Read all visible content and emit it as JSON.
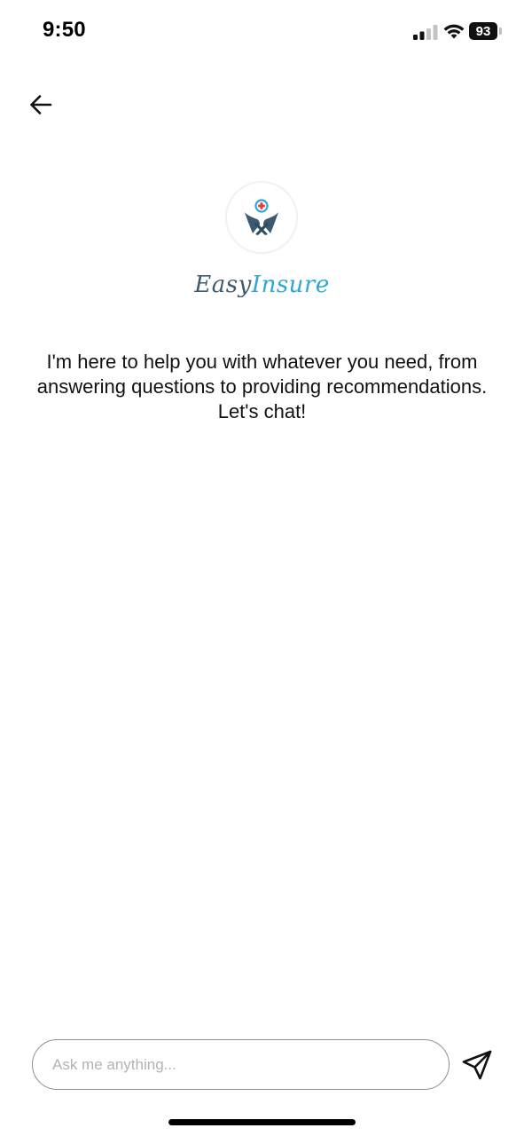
{
  "status_bar": {
    "time": "9:50",
    "battery_level": "93",
    "signal_icon": "cellular-signal-icon",
    "wifi_icon": "wifi-icon"
  },
  "nav": {
    "back_icon": "arrow-left-icon"
  },
  "brand": {
    "logo_icon": "hands-medical-cross-icon",
    "name_part_1": "Easy",
    "name_part_2": "Insure",
    "primary_color": "#3d5a70",
    "accent_color": "#2ea6d6",
    "cross_color": "#e03a3a"
  },
  "intro": {
    "message": "I'm here to help you with whatever you need, from answering questions to providing recommendations. Let's chat!"
  },
  "chat": {
    "input_placeholder": "Ask me anything...",
    "input_value": "",
    "send_icon": "send-paper-plane-icon"
  }
}
